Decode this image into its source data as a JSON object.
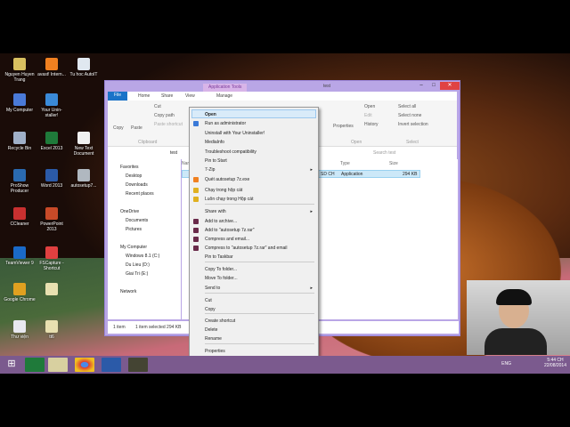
{
  "desktop_icons": [
    {
      "label": "Nguyen Huyen Trang",
      "icon": "folder-icon",
      "color": "#d8c060"
    },
    {
      "label": "avast! Intern...",
      "icon": "avast-icon",
      "color": "#f08020"
    },
    {
      "label": "Tu hoc AutoIT",
      "icon": "document-icon",
      "color": "#e0e8f0"
    },
    {
      "label": "My Computer",
      "icon": "computer-icon",
      "color": "#4a7ad8"
    },
    {
      "label": "Your Unin-staller!",
      "icon": "uninstaller-icon",
      "color": "#3a8ad8"
    },
    {
      "label": "Recycle Bin",
      "icon": "recycle-bin-icon",
      "color": "#a0b0c8"
    },
    {
      "label": "Excel 2013",
      "icon": "excel-icon",
      "color": "#1f7a3a"
    },
    {
      "label": "New Text Document",
      "icon": "text-file-icon",
      "color": "#f0f0f0"
    },
    {
      "label": "ProShow Producer",
      "icon": "proshow-icon",
      "color": "#2a6ab0"
    },
    {
      "label": "Word 2013",
      "icon": "word-icon",
      "color": "#2b5aa8"
    },
    {
      "label": "autosetup7...",
      "icon": "setup-icon",
      "color": "#b0b8c0"
    },
    {
      "label": "CCleaner",
      "icon": "ccleaner-icon",
      "color": "#c83030"
    },
    {
      "label": "PowerPoint 2013",
      "icon": "powerpoint-icon",
      "color": "#c84a28"
    },
    {
      "label": "TeamViewer 9",
      "icon": "teamviewer-icon",
      "color": "#1a6ac8"
    },
    {
      "label": "FSCapture - Shortcut",
      "icon": "fscapture-icon",
      "color": "#e04040"
    },
    {
      "label": "Google Chrome",
      "icon": "chrome-icon",
      "color": "#e0a020"
    },
    {
      "label": "",
      "icon": "archive-icon",
      "color": "#e8e0b0"
    },
    {
      "label": "Thư viện",
      "icon": "library-icon",
      "color": "#e8e8f0"
    },
    {
      "label": "tt6",
      "icon": "archive-icon",
      "color": "#e8e0b0"
    }
  ],
  "explorer": {
    "title": "test",
    "app_tools": "Application Tools",
    "tabs": [
      "File",
      "Home",
      "Share",
      "View",
      "Manage"
    ],
    "ribbon": {
      "copy": "Copy",
      "paste": "Paste",
      "cut": "Cut",
      "copy_path": "Copy path",
      "paste_shortcut": "Paste shortcut",
      "clipboard": "Clipboard",
      "properties": "Properties",
      "open": "Open",
      "edit": "Edit",
      "history": "History",
      "open_group": "Open",
      "select_all": "Select all",
      "select_none": "Select none",
      "invert_selection": "Invert selection",
      "select_group": "Select"
    },
    "address": "test",
    "search_placeholder": "Search test",
    "columns": [
      "Name",
      "Type",
      "Size"
    ],
    "nav": {
      "favorites": "Favorites",
      "desktop": "Desktop",
      "downloads": "Downloads",
      "recent": "Recent places",
      "onedrive": "OneDrive",
      "documents": "Documents",
      "pictures": "Pictures",
      "computer": "My Computer",
      "c": "Windows 8.1 (C:)",
      "d": "Du Lieu (D:)",
      "e": "Giai Tri (E:)",
      "network": "Network"
    },
    "file": {
      "date_fragment": "SD CH",
      "type": "Application",
      "size": "294 KB"
    },
    "status": {
      "items": "1 item",
      "selected": "1 item selected 294 KB"
    }
  },
  "context_menu": {
    "items": [
      "Open",
      "Run as administrator",
      "Uninstall with Your Uninstaller!",
      "MediaInfo",
      "Troubleshoot compatibility",
      "Pin to Start",
      "7-Zip",
      "Quét autosetup 7z.exe",
      "Chạy trong hộp cát",
      "Luôn chạy trong Hộp cát",
      "Share with",
      "Add to archive...",
      "Add to \"autosetup 7z.rar\"",
      "Compress and email...",
      "Compress to \"autosetup 7z.rar\" and email",
      "Pin to Taskbar",
      "Copy To folder...",
      "Move To folder...",
      "Send to",
      "Cut",
      "Copy",
      "Create shortcut",
      "Delete",
      "Rename",
      "Properties"
    ]
  },
  "tray": {
    "lang": "ENG",
    "time": "5:44 CH",
    "date": "22/08/2014"
  }
}
